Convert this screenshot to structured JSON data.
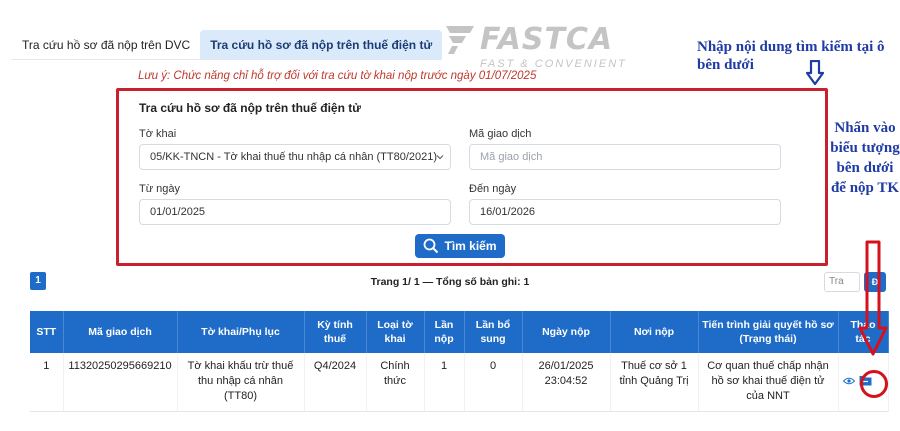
{
  "tabs": [
    {
      "label": "Tra cứu hồ sơ đã nộp trên DVC",
      "active": false
    },
    {
      "label": "Tra cứu hồ sơ đã nộp trên thuế điện tử",
      "active": true
    }
  ],
  "logo": {
    "name": "FASTCA",
    "tagline": "FAST & CONVENIENT"
  },
  "annotations": {
    "top": "Nhập nội dung tìm kiếm tại ô bên dưới",
    "side": "Nhấn vào biểu tượng bên dưới để nộp TK"
  },
  "warning": "Lưu ý: Chức năng chỉ hỗ trợ đối với tra cứu tờ khai nộp trước ngày 01/07/2025",
  "search": {
    "title": "Tra cứu hồ sơ đã nộp trên thuế điện tử",
    "form_label": "Tờ khai",
    "form_value": "05/KK-TNCN - Tờ khai thuế thu nhập cá nhân (TT80/2021)",
    "txn_label": "Mã giao dịch",
    "txn_placeholder": "Mã giao dịch",
    "from_label": "Từ ngày",
    "from_value": "01/01/2025",
    "to_label": "Đến ngày",
    "to_value": "16/01/2026",
    "button": "Tìm kiếm"
  },
  "pager": {
    "current": "1",
    "info": "Trang 1/ 1 — Tổng số bản ghi: 1",
    "size_label": "Tra",
    "go_label": "Đ"
  },
  "table": {
    "headers": [
      "STT",
      "Mã giao dịch",
      "Tờ khai/Phụ lục",
      "Kỳ tính thuế",
      "Loại tờ khai",
      "Lần nộp",
      "Lần bổ sung",
      "Ngày nộp",
      "Nơi nộp",
      "Tiến trình giải quyết hồ sơ (Trạng thái)",
      "Thao tác"
    ],
    "rows": [
      [
        "1",
        "11320250295669210",
        "Tờ khai khấu trừ thuế thu nhập cá nhân (TT80)",
        "Q4/2024",
        "Chính thức",
        "1",
        "0",
        "26/01/2025 23:04:52",
        "Thuế cơ sở 1 tỉnh Quảng Trị",
        "Cơ quan thuế chấp nhận hồ sơ khai thuế điện tử của NNT"
      ]
    ]
  },
  "colors": {
    "primary": "#1f6cc8",
    "highlight": "#c8202e",
    "annotation": "#1f3ba6",
    "warning": "#c0392b"
  }
}
